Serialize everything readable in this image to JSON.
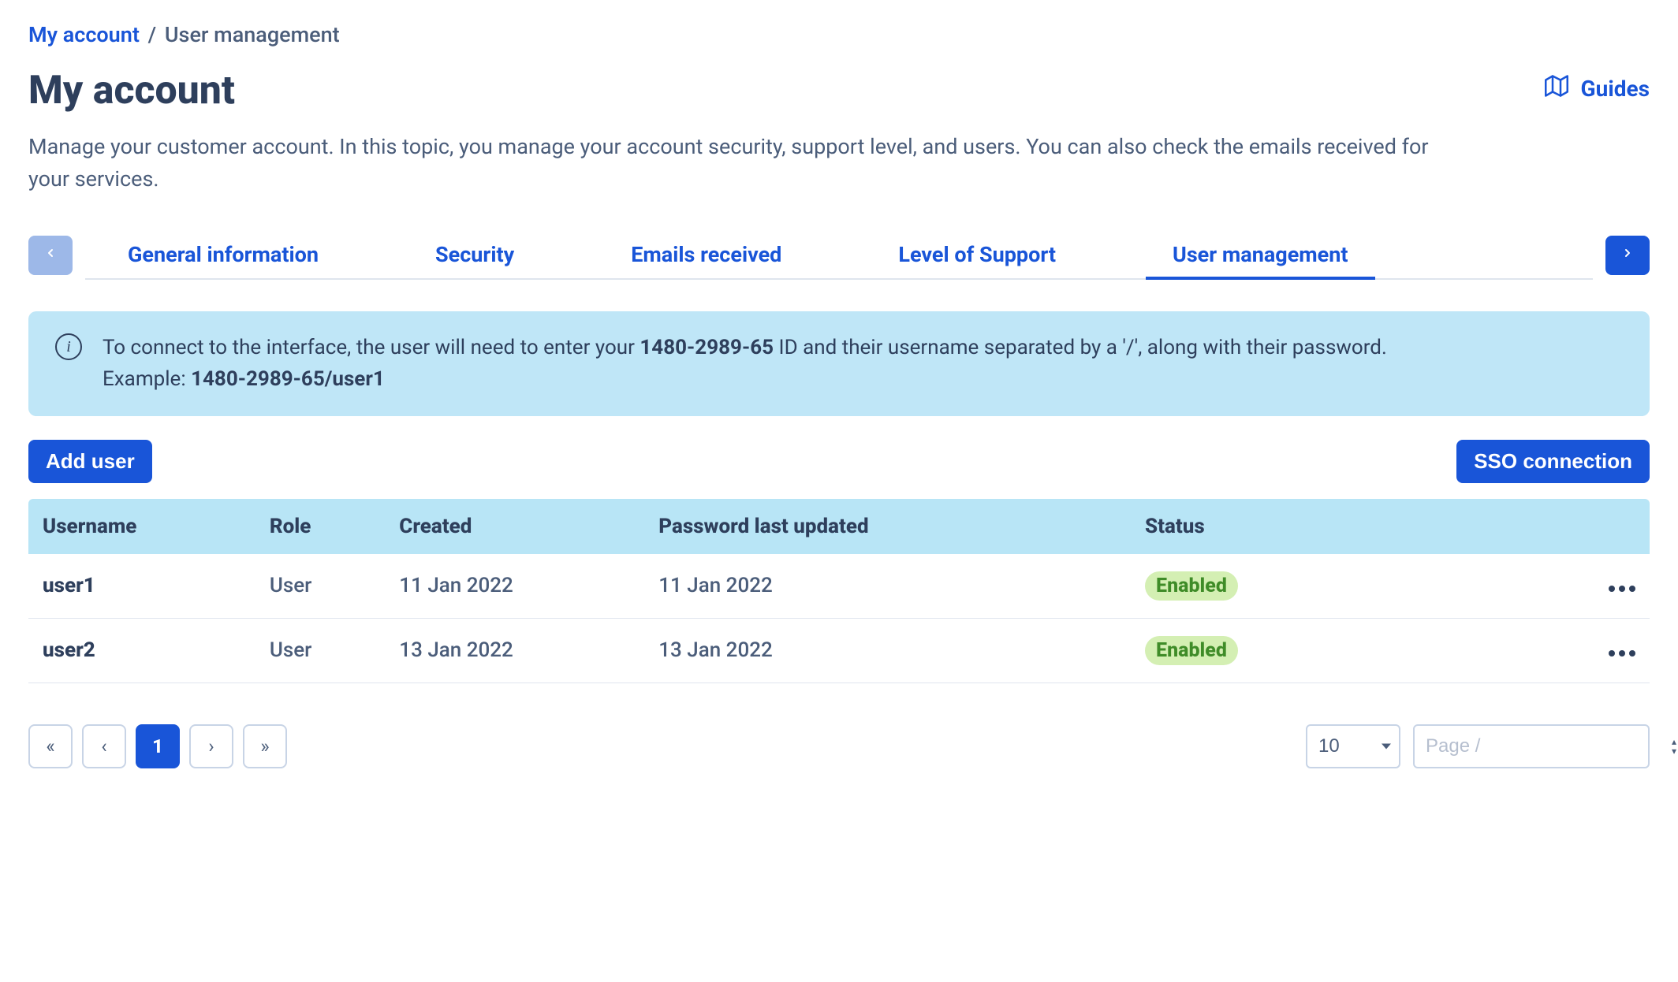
{
  "breadcrumb": {
    "root": "My account",
    "current": "User management"
  },
  "page_title": "My account",
  "lead": "Manage your customer account. In this topic, you manage your account security, support level, and users. You can also check the emails received for your services.",
  "guides_label": "Guides",
  "tabs": [
    {
      "label": "General information",
      "active": false
    },
    {
      "label": "Security",
      "active": false
    },
    {
      "label": "Emails received",
      "active": false
    },
    {
      "label": "Level of Support",
      "active": false
    },
    {
      "label": "User management",
      "active": true
    }
  ],
  "info": {
    "text_before_id": "To connect to the interface, the user will need to enter your ",
    "account_id": "1480-2989-65",
    "text_after_id": " ID and their username separated by a '/', along with their password.",
    "example_label": "Example: ",
    "example_value": "1480-2989-65/user1"
  },
  "buttons": {
    "add_user": "Add user",
    "sso": "SSO connection"
  },
  "table": {
    "headers": {
      "username": "Username",
      "role": "Role",
      "created": "Created",
      "pwd": "Password last updated",
      "status": "Status"
    },
    "rows": [
      {
        "username": "user1",
        "role": "User",
        "created": "11 Jan 2022",
        "pwd": "11 Jan 2022",
        "status": "Enabled"
      },
      {
        "username": "user2",
        "role": "User",
        "created": "13 Jan 2022",
        "pwd": "13 Jan 2022",
        "status": "Enabled"
      }
    ]
  },
  "pagination": {
    "first": "«",
    "prev": "‹",
    "current": "1",
    "next": "›",
    "last": "»",
    "page_size": "10",
    "page_placeholder": "Page /"
  }
}
